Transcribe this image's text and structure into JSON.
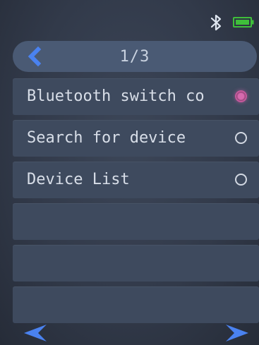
{
  "status_bar": {
    "icons": [
      "bluetooth-icon",
      "battery-icon"
    ],
    "battery_color": "#3fbf3a",
    "bluetooth_color": "#dfe6f0"
  },
  "header": {
    "back_icon": "chevron-left-icon",
    "page_indicator": "1/3"
  },
  "menu": {
    "items": [
      {
        "label": "Bluetooth switch co",
        "selected": true
      },
      {
        "label": "Search for device",
        "selected": false
      },
      {
        "label": "Device List",
        "selected": false
      },
      {
        "label": "",
        "selected": false
      },
      {
        "label": "",
        "selected": false
      },
      {
        "label": "",
        "selected": false
      }
    ]
  },
  "footer": {
    "prev_icon": "arrow-left-icon",
    "next_icon": "arrow-right-icon"
  },
  "colors": {
    "accent": "#3f74e8",
    "selected_radio": "#d66aae",
    "text": "#d8dee8"
  }
}
